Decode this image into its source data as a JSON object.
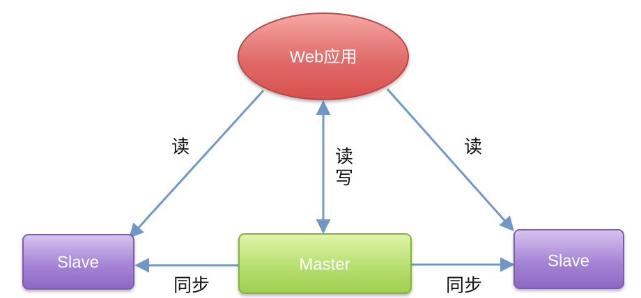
{
  "nodes": {
    "web_app": {
      "label": "Web应用",
      "fill_top": "#f6a7a4",
      "fill_bottom": "#d84f4e",
      "stroke": "#b74a47"
    },
    "master": {
      "label": "Master",
      "fill_top": "#e0f4a8",
      "fill_bottom": "#9fcf4f",
      "stroke": "#85b23d"
    },
    "slave_left": {
      "label": "Slave",
      "fill_top": "#d8c4ee",
      "fill_bottom": "#8e68c4",
      "stroke": "#7e5ab1"
    },
    "slave_right": {
      "label": "Slave",
      "fill_top": "#d8c4ee",
      "fill_bottom": "#8e68c4",
      "stroke": "#7e5ab1"
    }
  },
  "edges": {
    "web_to_slave_left": "读",
    "web_master": [
      "读",
      "写"
    ],
    "web_to_slave_right": "读",
    "master_to_slave_left": "同步",
    "master_to_slave_right": "同步"
  },
  "colors": {
    "arrow": "#6f98c8",
    "text": "#111111"
  }
}
